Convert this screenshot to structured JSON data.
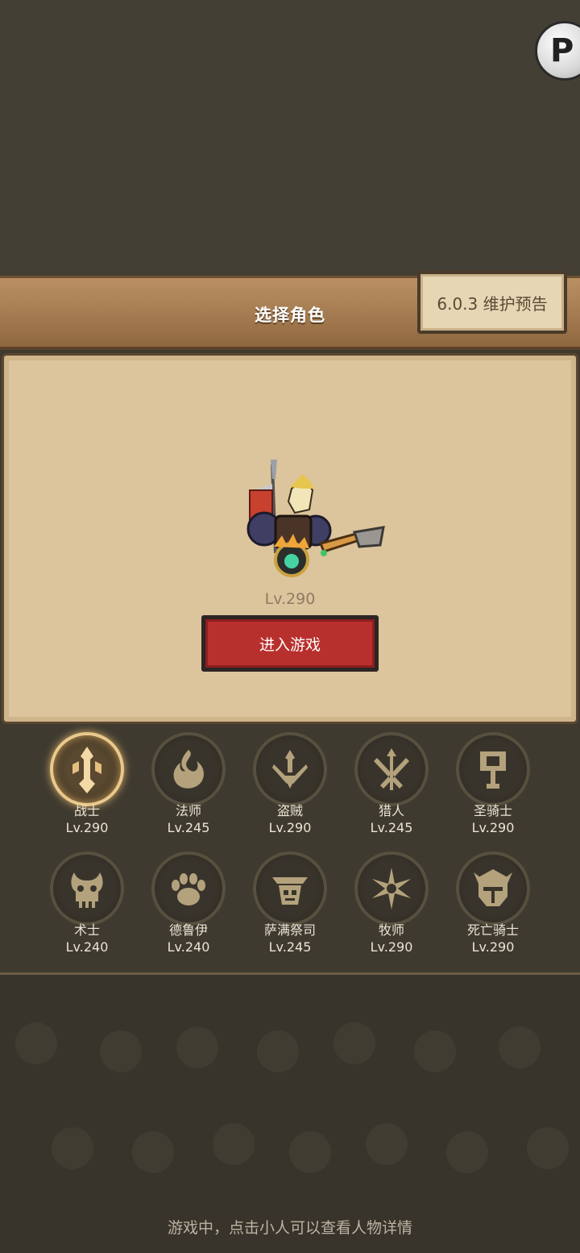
{
  "header": {
    "title": "选择角色",
    "notice_label": "6.0.3 维护预告",
    "corner_label": "P"
  },
  "hero": {
    "level": "Lv.290",
    "enter_label": "进入游戏"
  },
  "classes": [
    {
      "name": "战士",
      "level": "Lv.290",
      "icon": "sword-icon",
      "selected": true
    },
    {
      "name": "法师",
      "level": "Lv.245",
      "icon": "flame-icon"
    },
    {
      "name": "盗贼",
      "level": "Lv.290",
      "icon": "daggers-icon"
    },
    {
      "name": "猎人",
      "level": "Lv.245",
      "icon": "arrows-icon"
    },
    {
      "name": "圣骑士",
      "level": "Lv.290",
      "icon": "hammer-icon"
    },
    {
      "name": "术士",
      "level": "Lv.240",
      "icon": "skull-icon"
    },
    {
      "name": "德鲁伊",
      "level": "Lv.240",
      "icon": "paw-icon"
    },
    {
      "name": "萨满祭司",
      "level": "Lv.245",
      "icon": "totem-icon"
    },
    {
      "name": "牧师",
      "level": "Lv.290",
      "icon": "star-icon"
    },
    {
      "name": "死亡骑士",
      "level": "Lv.290",
      "icon": "helm-icon"
    }
  ],
  "footer": {
    "hint": "游戏中，点击小人可以查看人物详情"
  },
  "colors": {
    "accent": "#b8302e",
    "panel": "#dcc49c",
    "gold": "#e9c98c"
  }
}
